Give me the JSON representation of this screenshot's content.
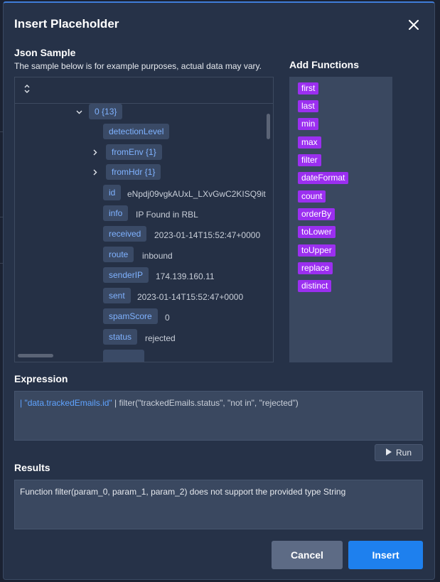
{
  "dialog": {
    "title": "Insert Placeholder",
    "close_icon": "close-icon"
  },
  "json_sample": {
    "label": "Json Sample",
    "note": "The sample below is for example purposes, actual data may vary.",
    "root_node": "0 {13}",
    "fields": [
      {
        "key": "detectionLevel",
        "value": ""
      },
      {
        "key": "fromEnv {1}",
        "value": "",
        "expandable": true
      },
      {
        "key": "fromHdr {1}",
        "value": "",
        "expandable": true
      },
      {
        "key": "id",
        "value": "eNpdj09vgkAUxL_LXvGwC2KISQ9it"
      },
      {
        "key": "info",
        "value": "IP Found in RBL"
      },
      {
        "key": "received",
        "value": "2023-01-14T15:52:47+0000"
      },
      {
        "key": "route",
        "value": "inbound"
      },
      {
        "key": "senderIP",
        "value": "174.139.160.11"
      },
      {
        "key": "sent",
        "value": "2023-01-14T15:52:47+0000"
      },
      {
        "key": "spamScore",
        "value": "0"
      },
      {
        "key": "status",
        "value": "rejected"
      }
    ]
  },
  "functions": {
    "label": "Add Functions",
    "items": [
      "first",
      "last",
      "min",
      "max",
      "filter",
      "dateFormat",
      "count",
      "orderBy",
      "toLower",
      "toUpper",
      "replace",
      "distinct"
    ]
  },
  "expression": {
    "label": "Expression",
    "prefix": "| ",
    "path": "\"data.trackedEmails.id\"",
    "rest": " | filter(\"trackedEmails.status\", \"not in\", \"rejected\")"
  },
  "run_button": {
    "label": "Run"
  },
  "results": {
    "label": "Results",
    "text": "Function filter(param_0, param_1, param_2) does not support the provided type String"
  },
  "footer": {
    "cancel_label": "Cancel",
    "insert_label": "Insert"
  },
  "colors": {
    "accent": "#1e80ee",
    "function_tag": "#9b2ff0",
    "key_text": "#7fb2ff"
  }
}
